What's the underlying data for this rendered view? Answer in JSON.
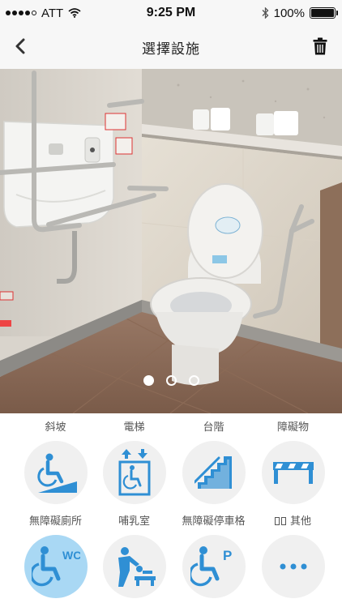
{
  "status_bar": {
    "carrier": "ATT",
    "time": "9:25 PM",
    "battery": "100%"
  },
  "nav": {
    "title": "選擇設施"
  },
  "carousel": {
    "page_count": 3,
    "active_index": 0
  },
  "facilities": [
    {
      "label": "斜坡",
      "icon": "ramp-icon",
      "selected": false
    },
    {
      "label": "電梯",
      "icon": "elevator-icon",
      "selected": false
    },
    {
      "label": "台階",
      "icon": "stairs-icon",
      "selected": false
    },
    {
      "label": "障礙物",
      "icon": "obstacle-icon",
      "selected": false
    },
    {
      "label": "無障礙廁所",
      "icon": "accessible-toilet-icon",
      "selected": true,
      "icon_text": "WC"
    },
    {
      "label": "哺乳室",
      "icon": "nursing-room-icon",
      "selected": false
    },
    {
      "label": "無障礙停車格",
      "icon": "accessible-parking-icon",
      "selected": false,
      "icon_text": "P"
    },
    {
      "label": "其他",
      "icon": "more-icon",
      "selected": false
    }
  ],
  "colors": {
    "icon_blue": "#2f8fd4",
    "selected_bg": "#a9d8f4",
    "circle_bg": "#f0f0f0"
  }
}
